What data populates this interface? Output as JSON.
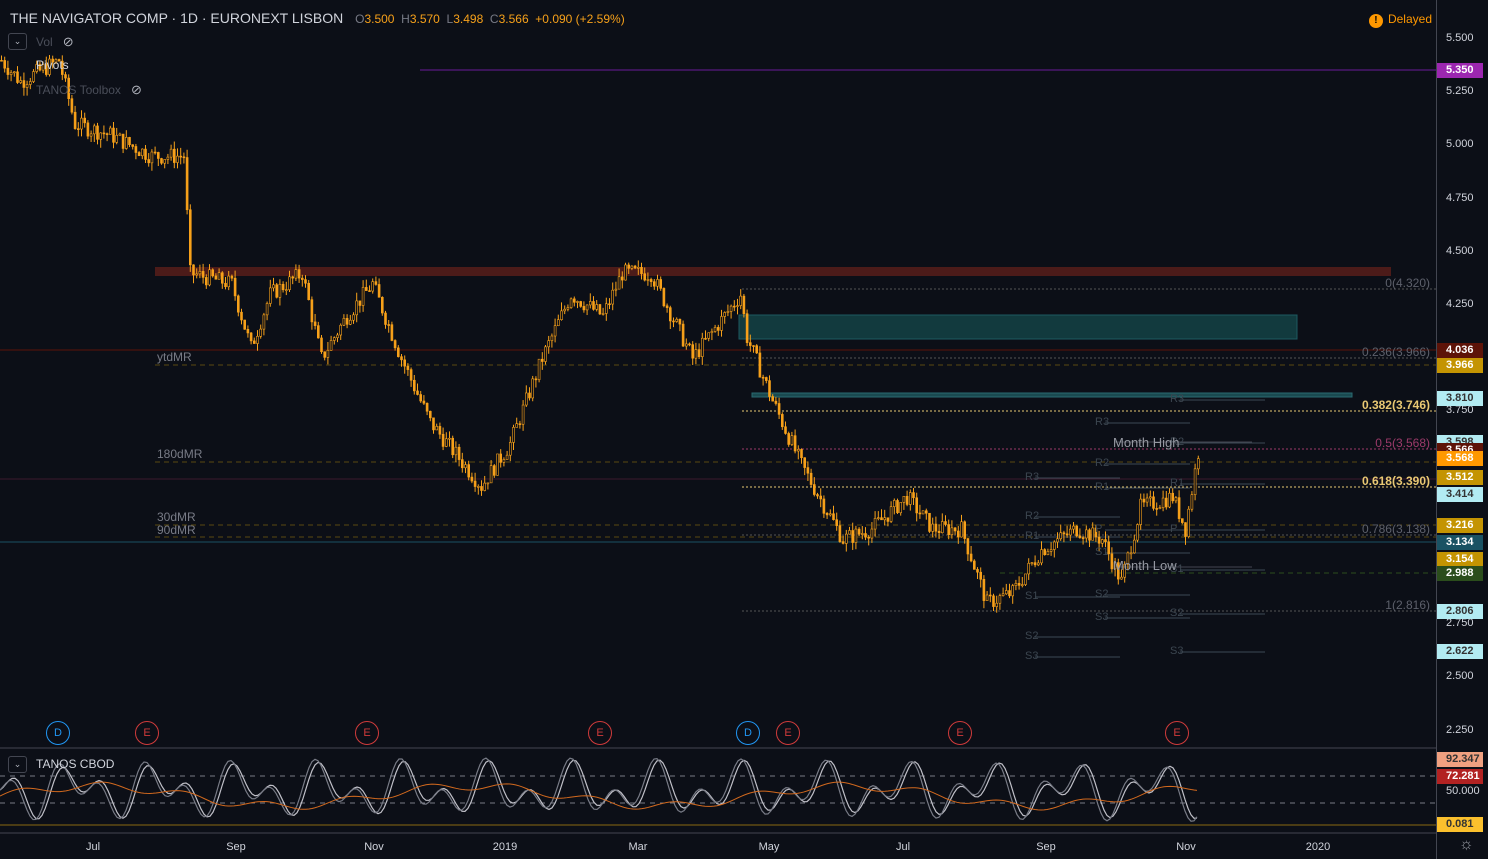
{
  "header": {
    "symbol": "THE NAVIGATOR COMP · 1D · EURONEXT LISBON",
    "o_label": "O",
    "o": "3.500",
    "h_label": "H",
    "h": "3.570",
    "l_label": "L",
    "l": "3.498",
    "c_label": "C",
    "c": "3.566",
    "change": "+0.090 (+2.59%)"
  },
  "delayed": "Delayed",
  "legend": {
    "vol": "Vol",
    "pivots": "Pivots",
    "toolbox": "TANOS Toolbox",
    "osc": "TANOS CBOD"
  },
  "price_ticks": [
    "5.500",
    "5.250",
    "5.000",
    "4.750",
    "4.500",
    "4.250",
    "3.750",
    "2.750",
    "2.500",
    "2.250"
  ],
  "price_tags": [
    {
      "v": "5.350",
      "bg": "#9c27b0",
      "fg": "#fff"
    },
    {
      "v": "4.036",
      "bg": "#5d1308",
      "fg": "#fff"
    },
    {
      "v": "3.966",
      "bg": "#c49402",
      "fg": "#fff"
    },
    {
      "v": "3.810",
      "bg": "#b2ebf2",
      "fg": "#333"
    },
    {
      "v": "3.598",
      "bg": "#b2ebf2",
      "fg": "#333"
    },
    {
      "v": "3.566",
      "bg": "#5d1308",
      "fg": "#fff"
    },
    {
      "v": "3.568",
      "bg": "#ff9800",
      "fg": "#fff"
    },
    {
      "v": "3.512",
      "bg": "#c49402",
      "fg": "#fff"
    },
    {
      "v": "3.414",
      "bg": "#b2ebf2",
      "fg": "#333"
    },
    {
      "v": "3.216",
      "bg": "#c49402",
      "fg": "#fff"
    },
    {
      "v": "3.134",
      "bg": "#1a5263",
      "fg": "#fff"
    },
    {
      "v": "3.154",
      "bg": "#c49402",
      "fg": "#fff"
    },
    {
      "v": "2.988",
      "bg": "#2b4d1c",
      "fg": "#fff"
    },
    {
      "v": "2.806",
      "bg": "#b2ebf2",
      "fg": "#333"
    },
    {
      "v": "2.622",
      "bg": "#b2ebf2",
      "fg": "#333"
    }
  ],
  "osc_ticks": [
    "50.000"
  ],
  "osc_tags": [
    {
      "v": "92.347",
      "bg": "#f0a080",
      "fg": "#333"
    },
    {
      "v": "72.281",
      "bg": "#b22222",
      "fg": "#fff"
    },
    {
      "v": "0.081",
      "bg": "#fbc02d",
      "fg": "#333"
    }
  ],
  "time_labels": [
    "Jul",
    "Sep",
    "Nov",
    "2019",
    "Mar",
    "May",
    "Jul",
    "Sep",
    "Nov",
    "2020"
  ],
  "fib": [
    "0(4.320)",
    "0.236(3.966)",
    "0.382(3.746)",
    "0.5(3.568)",
    "0.618(3.390)",
    "0.786(3.138)",
    "1(2.816)"
  ],
  "mr": [
    "ytdMR",
    "180dMR",
    "30dMR",
    "90dMR"
  ],
  "month": {
    "high": "Month High",
    "low": "Month Low"
  },
  "pivots": [
    "R3",
    "R2",
    "R1",
    "P",
    "S1",
    "S2",
    "S3"
  ],
  "events": [
    "D",
    "E",
    "E",
    "E",
    "D",
    "E",
    "E",
    "E"
  ],
  "colors": {
    "candle": "#f7a11a",
    "accent": "#ff9800"
  },
  "chart_data": {
    "type": "candlestick",
    "ylim": [
      2.2,
      5.55
    ],
    "keypoints": [
      [
        0,
        5.4
      ],
      [
        6,
        5.3
      ],
      [
        18,
        5.4
      ],
      [
        23,
        5.1
      ],
      [
        34,
        5.05
      ],
      [
        47,
        4.95
      ],
      [
        57,
        4.95
      ],
      [
        59,
        4.4
      ],
      [
        72,
        4.35
      ],
      [
        78,
        4.05
      ],
      [
        84,
        4.3
      ],
      [
        94,
        4.4
      ],
      [
        100,
        4.0
      ],
      [
        108,
        4.2
      ],
      [
        116,
        4.35
      ],
      [
        125,
        4.0
      ],
      [
        134,
        3.7
      ],
      [
        150,
        3.4
      ],
      [
        159,
        3.6
      ],
      [
        169,
        4.0
      ],
      [
        178,
        4.3
      ],
      [
        188,
        4.2
      ],
      [
        194,
        4.4
      ],
      [
        203,
        4.4
      ],
      [
        216,
        4.0
      ],
      [
        231,
        4.3
      ],
      [
        233,
        4.1
      ],
      [
        241,
        3.8
      ],
      [
        250,
        3.5
      ],
      [
        263,
        3.15
      ],
      [
        272,
        3.2
      ],
      [
        283,
        3.35
      ],
      [
        291,
        3.2
      ],
      [
        300,
        3.2
      ],
      [
        308,
        2.85
      ],
      [
        316,
        2.9
      ],
      [
        325,
        3.1
      ],
      [
        336,
        3.2
      ],
      [
        344,
        3.15
      ],
      [
        350,
        2.95
      ],
      [
        356,
        3.3
      ],
      [
        366,
        3.35
      ],
      [
        370,
        3.2
      ],
      [
        374,
        3.56
      ]
    ]
  }
}
